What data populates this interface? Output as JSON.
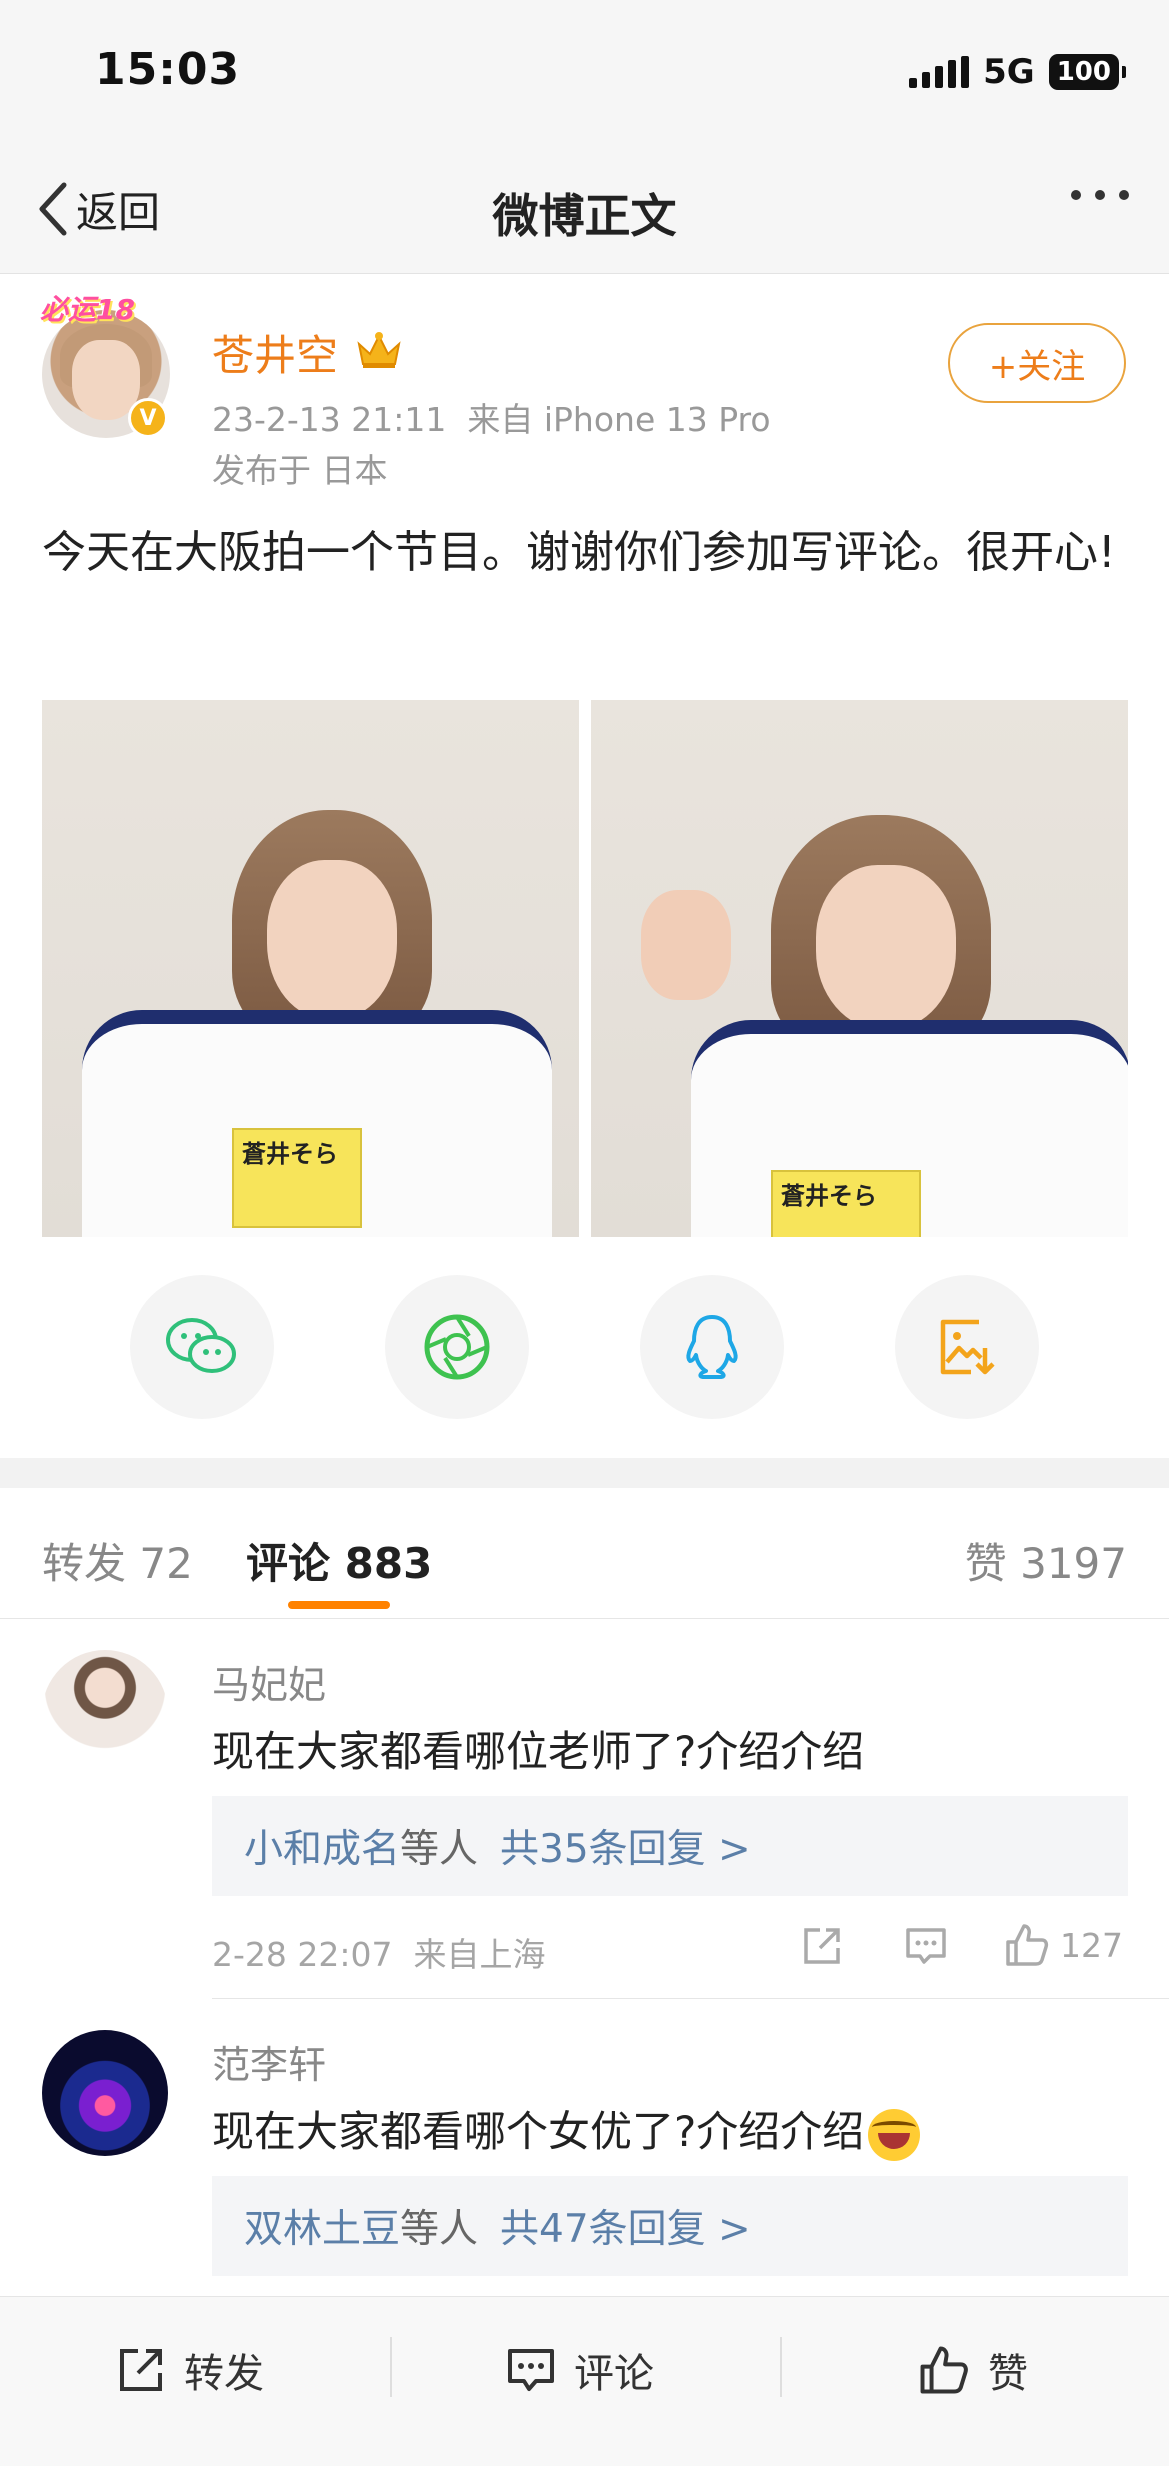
{
  "status_bar": {
    "time": "15:03",
    "network": "5G",
    "battery": "100"
  },
  "nav": {
    "back_label": "返回",
    "title": "微博正文"
  },
  "post": {
    "badge_text": "必运18",
    "verified_mark": "V",
    "author": "苍井空",
    "datetime": "23-2-13 21:11",
    "source": "来自 iPhone 13 Pro",
    "location": "发布于 日本",
    "follow_label": "+关注",
    "text": "今天在大阪拍一个节目。谢谢你们参加写评论。很开心!",
    "images": [
      {
        "tag_text": "蒼井そら"
      },
      {
        "tag_text": "蒼井そら"
      }
    ]
  },
  "share_icons": [
    "wechat-icon",
    "moments-icon",
    "qq-icon",
    "save-image-icon"
  ],
  "tabs": {
    "reposts": "转发 72",
    "comments": "评论 883",
    "likes": "赞 3197"
  },
  "comments": [
    {
      "user": "马妃妃",
      "text": "现在大家都看哪位老师了?介绍介绍",
      "reply_names": "小和成名",
      "reply_mid": "等人",
      "reply_count": "共35条回复 >",
      "time": "2-28 22:07",
      "source": "来自上海",
      "like_count": "127"
    },
    {
      "user": "范李轩",
      "text": "现在大家都看哪个女优了?介绍介绍",
      "reply_names": "双林土豆",
      "reply_mid": "等人",
      "reply_count": "共47条回复 >"
    }
  ],
  "bottom_bar": {
    "repost": "转发",
    "comment": "评论",
    "like": "赞"
  },
  "colors": {
    "accent_orange": "#ff8200",
    "username_orange": "#ed7d1a",
    "link_blue": "#5b7fa8",
    "verified_gold": "#f5b31a"
  }
}
